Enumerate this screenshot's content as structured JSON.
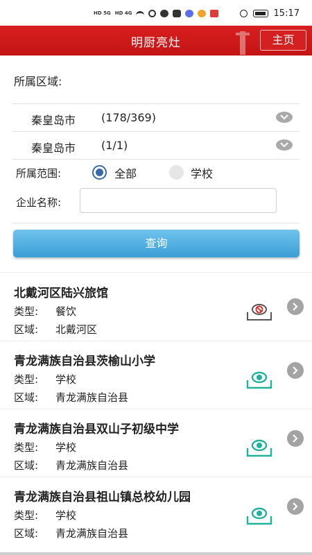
{
  "status_bar": {
    "network_left": "HD 5G",
    "network_right": "HD 4G",
    "time": "15:17"
  },
  "header": {
    "title": "明厨亮灶",
    "home_label": "主页"
  },
  "filters": {
    "region_label": "所属区域:",
    "selects": [
      {
        "city": "秦皇岛市",
        "count": "(178/369)"
      },
      {
        "city": "秦皇岛市",
        "count": "(1/1)"
      }
    ],
    "scope_label": "所属范围:",
    "scope_options": [
      {
        "label": "全部",
        "selected": true
      },
      {
        "label": "学校",
        "selected": false
      }
    ],
    "name_label": "企业名称:",
    "name_value": "",
    "name_placeholder": "",
    "query_label": "查询"
  },
  "list": {
    "items": [
      {
        "name": "北戴河区陆兴旅馆",
        "type_key": "类型:",
        "type": "餐饮",
        "area_key": "区域:",
        "area": "北戴河区",
        "camera": "offline"
      },
      {
        "name": "青龙满族自治县茨榆山小学",
        "type_key": "类型:",
        "type": "学校",
        "area_key": "区域:",
        "area": "青龙满族自治县",
        "camera": "online"
      },
      {
        "name": "青龙满族自治县双山子初级中学",
        "type_key": "类型:",
        "type": "学校",
        "area_key": "区域:",
        "area": "青龙满族自治县",
        "camera": "online"
      },
      {
        "name": "青龙满族自治县祖山镇总校幼儿园",
        "type_key": "类型:",
        "type": "学校",
        "area_key": "区域:",
        "area": "青龙满族自治县",
        "camera": "online"
      }
    ]
  },
  "colors": {
    "header_red": "#c81818",
    "query_blue": "#3b9ed6",
    "camera_online": "#20b29a",
    "camera_offline": "#666666",
    "radio_blue": "#3a6aa5"
  }
}
